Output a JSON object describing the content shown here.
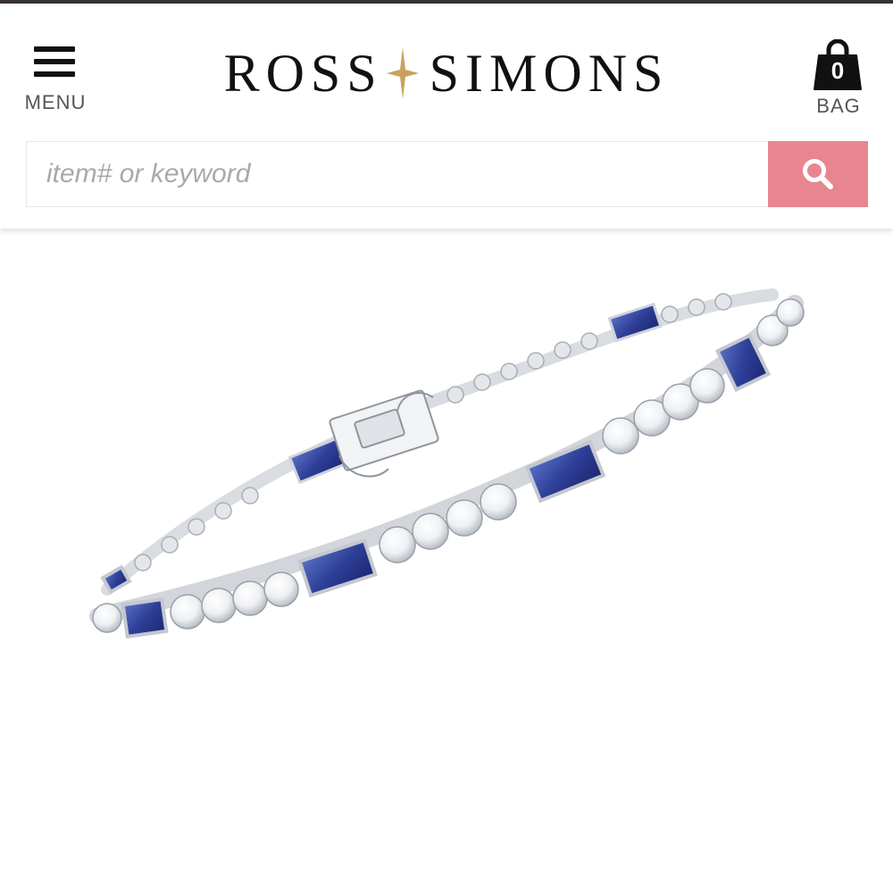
{
  "header": {
    "menu_label": "MENU",
    "logo_left": "ROSS",
    "logo_right": "SIMONS",
    "bag_count": "0",
    "bag_label": "BAG",
    "icons": {
      "menu": "hamburger-icon",
      "bag": "shopping-bag-icon",
      "search": "magnifier-icon",
      "logo_star": "four-point-star-icon"
    }
  },
  "search": {
    "placeholder": "item# or keyword",
    "value": ""
  },
  "colors": {
    "top_bar": "#3a3333",
    "search_button": "#e88690",
    "logo_star": "#c9a15e",
    "text": "#111111",
    "label": "#555555"
  },
  "product": {
    "image_subject": "sapphire-and-white-stone-tennis-bracelet"
  }
}
